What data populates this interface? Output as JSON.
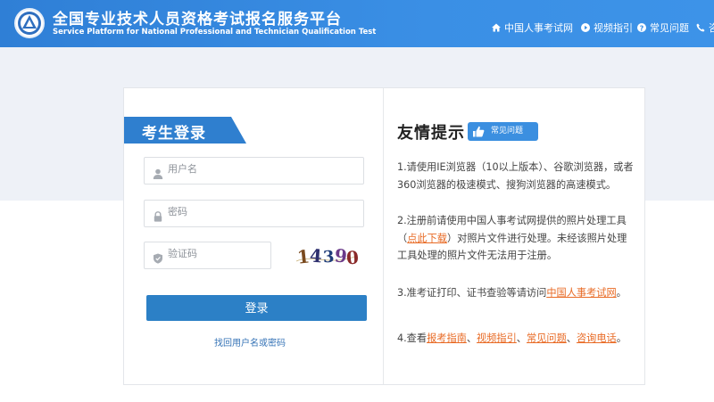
{
  "header": {
    "title_cn": "全国专业技术人员资格考试报名服务平台",
    "title_en": "Service Platform for National Professional and Technician Qualification Test",
    "nav": {
      "home": "中国人事考试网",
      "video": "视频指引",
      "faq": "常见问题",
      "phone": "咨"
    }
  },
  "login": {
    "title": "考生登录",
    "username_placeholder": "用户名",
    "password_placeholder": "密码",
    "code_placeholder": "验证码",
    "captcha_chars": [
      "1",
      "4",
      "3",
      "9",
      "0"
    ],
    "submit_label": "登录",
    "recover_label": "找回用户名或密码"
  },
  "tips": {
    "title": "友情提示",
    "faq_badge": "常见问题",
    "tip1": "1.请使用IE浏览器（10以上版本）、谷歌浏览器，或者360浏览器的极速模式、搜狗浏览器的高速模式。",
    "tip2_pre": "2.注册前请使用中国人事考试网提供的照片处理工具（",
    "tip2_link": "点此下载",
    "tip2_post": "）对照片文件进行处理。未经该照片处理工具处理的照片文件无法用于注册。",
    "tip3_pre": "3.准考证打印、证书查验等请访问",
    "tip3_link": "中国人事考试网",
    "tip3_post": "。",
    "tip4_pre": "4.查看",
    "tip4_link1": "报考指南",
    "tip4_sep1": "、",
    "tip4_link2": "视频指引",
    "tip4_sep2": "、",
    "tip4_link3": "常见问题",
    "tip4_sep3": "、",
    "tip4_link4": "咨询电话",
    "tip4_post": "。"
  },
  "colors": {
    "header_blue": "#3a8fe5",
    "button_blue": "#2c80c6",
    "link_orange": "#e86a24",
    "band_gray": "#eef1f7"
  }
}
